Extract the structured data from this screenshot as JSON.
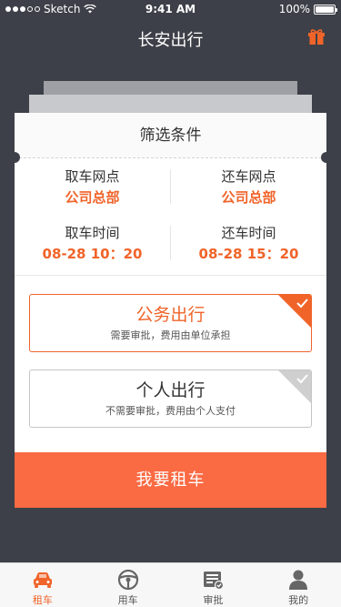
{
  "status_bar": {
    "carrier": "Sketch",
    "time": "9:41 AM",
    "battery": "100%"
  },
  "header": {
    "title": "长安出行",
    "gift_icon": "gift-icon"
  },
  "card": {
    "title": "筛选条件",
    "pickup_location": {
      "label": "取车网点",
      "value": "公司总部"
    },
    "return_location": {
      "label": "还车网点",
      "value": "公司总部"
    },
    "pickup_time": {
      "label": "取车时间",
      "value": "08-28 10：20"
    },
    "return_time": {
      "label": "还车时间",
      "value": "08-28 15：20"
    },
    "options": [
      {
        "title": "公务出行",
        "subtitle": "需要审批，费用由单位承担",
        "selected": true
      },
      {
        "title": "个人出行",
        "subtitle": "不需要审批，费用由个人支付",
        "selected": false
      }
    ],
    "submit_label": "我要租车"
  },
  "tabbar": {
    "items": [
      {
        "label": "租车",
        "icon": "car-icon",
        "active": true
      },
      {
        "label": "用车",
        "icon": "steering-wheel-icon",
        "active": false
      },
      {
        "label": "审批",
        "icon": "approval-icon",
        "active": false
      },
      {
        "label": "我的",
        "icon": "user-icon",
        "active": false
      }
    ]
  },
  "colors": {
    "accent": "#f0642a",
    "button": "#fa6a43",
    "background": "#3d4048"
  }
}
